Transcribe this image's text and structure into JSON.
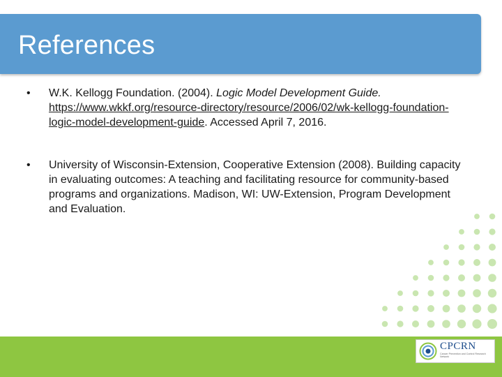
{
  "header": {
    "title": "References"
  },
  "references": [
    {
      "bullet": "•",
      "text_before": "W.K. Kellogg Foundation. (2004). ",
      "title_italic": "Logic Model Development Guide.",
      "url": "https://www.wkkf.org/resource-directory/resource/2006/02/wk-kellogg-foundation-logic-model-development-guide",
      "text_after": ". Accessed April 7, 2016."
    },
    {
      "bullet": "•",
      "text": "University of Wisconsin-Extension, Cooperative Extension (2008). Building capacity in evaluating outcomes: A teaching and facilitating resource for community-based programs and organizations. Madison, WI: UW-Extension, Program Development and Evaluation."
    }
  ],
  "logo": {
    "name": "CPCRN",
    "tagline": "Cancer Prevention and Control Research Network"
  },
  "colors": {
    "header_band": "#5b9bd0",
    "footer_band": "#8ec641",
    "dot_green": "#c9e6b0",
    "logo_text": "#1f4e8c"
  }
}
